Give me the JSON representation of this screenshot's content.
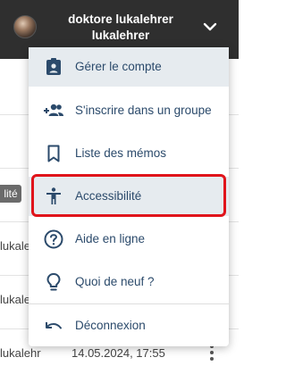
{
  "header": {
    "username": "doktore lukalehrer lukalehrer",
    "avatar_icon": "user-avatar",
    "caret_icon": "chevron-down-icon",
    "background_color": "#2f2f2f"
  },
  "background": {
    "badge": "lité",
    "rows": [
      "lukalehr",
      "lukalehr",
      "lukalehr",
      "lukalehr"
    ],
    "last_date": "14.05.2024, 17:55"
  },
  "menu": {
    "items": [
      {
        "label": "Gérer le compte",
        "icon": "account-box-icon",
        "state": "hover"
      },
      {
        "label": "S'inscrire dans un groupe",
        "icon": "group-add-icon"
      },
      {
        "label": "Liste des mémos",
        "icon": "bookmark-icon"
      },
      {
        "label": "Accessibilité",
        "icon": "accessibility-icon",
        "state": "highlighted"
      },
      {
        "label": "Aide en ligne",
        "icon": "help-icon"
      },
      {
        "label": "Quoi de neuf ?",
        "icon": "lightbulb-icon"
      },
      {
        "label": "Déconnexion",
        "icon": "undo-icon"
      }
    ],
    "text_color": "#2b4a6b",
    "highlight_color": "#e0141b"
  }
}
